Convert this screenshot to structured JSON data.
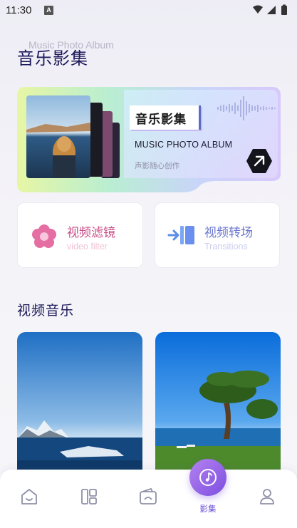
{
  "status_bar": {
    "time": "11:30",
    "notification_glyph": "A"
  },
  "header": {
    "ghost_title": "Music Photo Album",
    "title": "音乐影集"
  },
  "hero": {
    "title": "音乐影集",
    "subtitle": "MUSIC PHOTO ALBUM",
    "tagline": "声影随心创作"
  },
  "features": [
    {
      "title": "视频滤镜",
      "subtitle": "video filter",
      "icon": "flower-icon"
    },
    {
      "title": "视频转场",
      "subtitle": "Transitions",
      "icon": "transition-icon"
    }
  ],
  "section": {
    "title": "视频音乐"
  },
  "tiles": [
    {
      "icon": "sea-town-photo"
    },
    {
      "icon": "tree-photo"
    }
  ],
  "bottom_nav": {
    "items": [
      {
        "icon": "home-icon"
      },
      {
        "icon": "layout-icon"
      },
      {
        "icon": "wallet-icon"
      },
      {
        "icon": "music-note-icon",
        "label": "影集",
        "active": true
      },
      {
        "icon": "profile-icon"
      }
    ]
  },
  "colors": {
    "accent": "#7c4fe0",
    "title": "#1c1a5a",
    "filter_pink": "#c94d86",
    "transition_blue": "#6b77cf"
  }
}
